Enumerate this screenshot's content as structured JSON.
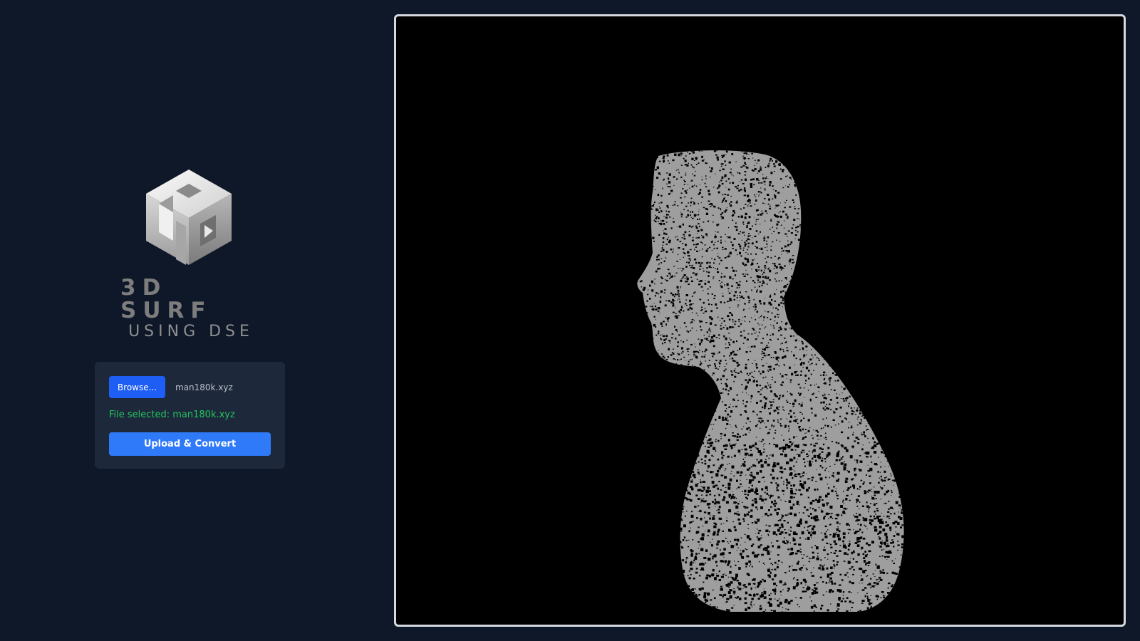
{
  "brand": {
    "title": "3D SURF",
    "subtitle": "USING DSE",
    "logo_icon": "isometric-cube-logo"
  },
  "upload": {
    "browse_label": "Browse...",
    "file_name": "man180k.xyz",
    "status_text": "File selected: man180k.xyz",
    "convert_label": "Upload & Convert"
  },
  "viewer": {
    "content": "point-cloud-man-bust-profile"
  },
  "colors": {
    "background": "#0f1829",
    "card": "#1d293b",
    "browse_button": "#1f5ef5",
    "convert_button": "#2f7af8",
    "success_text": "#22c55e",
    "viewer_border": "#d5d9e0",
    "points": "#bdbdbd"
  }
}
